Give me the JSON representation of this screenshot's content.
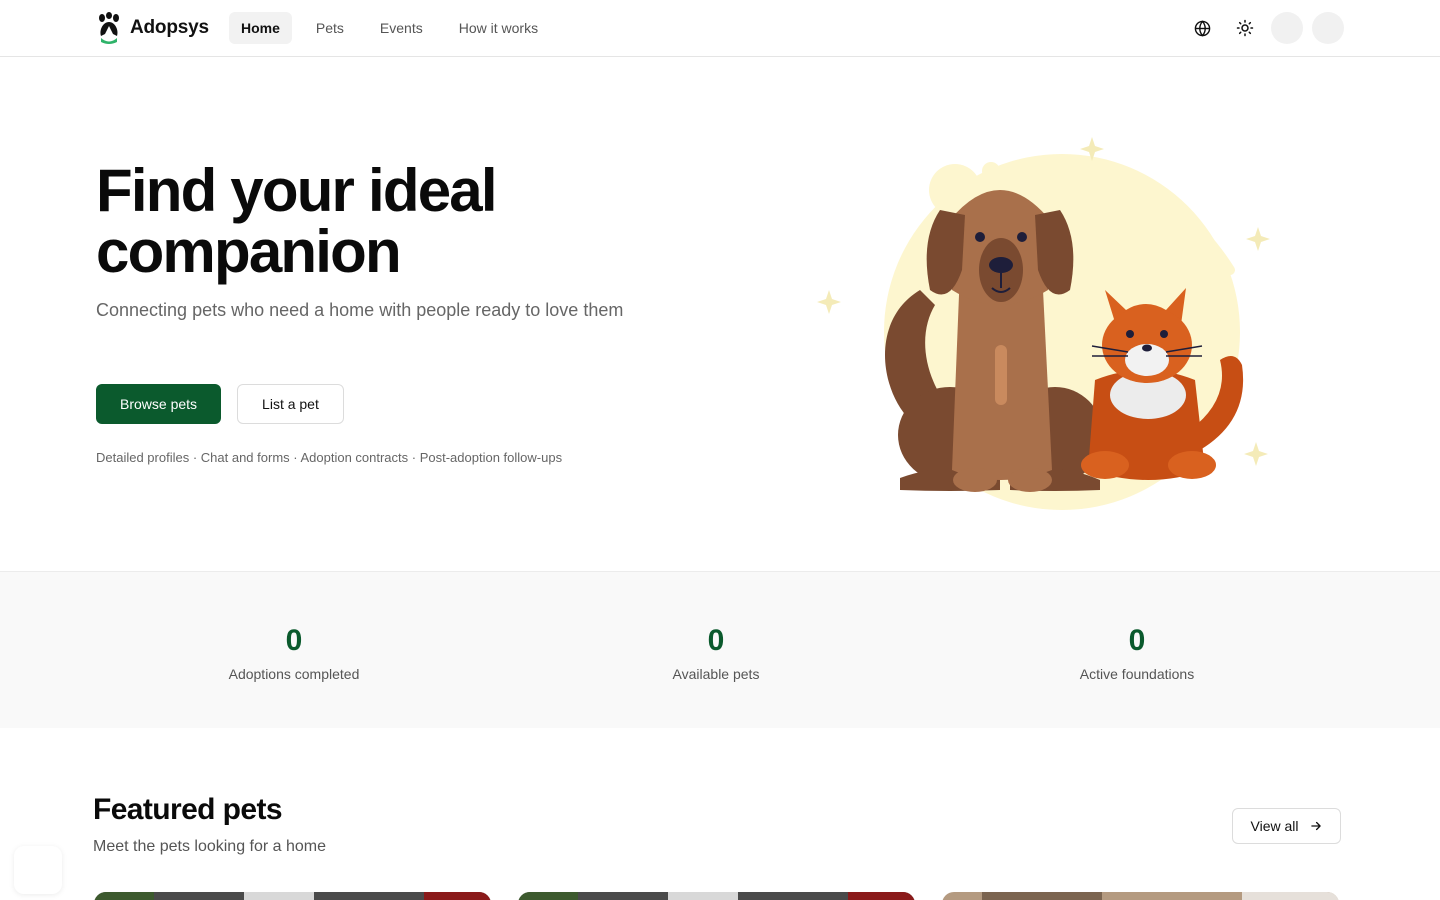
{
  "brand": {
    "name": "Adopsys"
  },
  "nav": {
    "items": [
      {
        "label": "Home",
        "active": true
      },
      {
        "label": "Pets"
      },
      {
        "label": "Events"
      },
      {
        "label": "How it works"
      }
    ]
  },
  "header_icons": {
    "language": "globe-icon",
    "theme": "sun-icon"
  },
  "hero": {
    "title": "Find your ideal companion",
    "subtitle": "Connecting pets who need a home with people ready to love them",
    "primary_button": "Browse pets",
    "secondary_button": "List a pet",
    "features": "Detailed profiles · Chat and forms · Adoption contracts · Post-adoption follow-ups"
  },
  "stats": [
    {
      "value": "0",
      "label": "Adoptions completed"
    },
    {
      "value": "0",
      "label": "Available pets"
    },
    {
      "value": "0",
      "label": "Active foundations"
    }
  ],
  "featured": {
    "title": "Featured pets",
    "subtitle": "Meet the pets looking for a home",
    "view_all": "View all"
  },
  "colors": {
    "brand_green": "#0b5a2d",
    "accent_yellow": "#fdf6cf"
  }
}
